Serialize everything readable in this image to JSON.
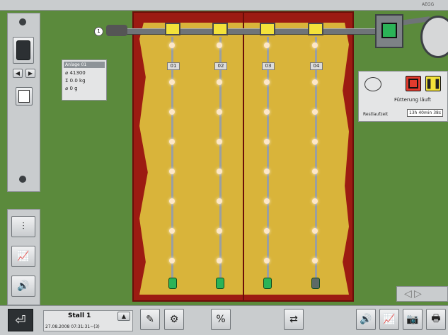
{
  "header": {
    "brand": "AEGG"
  },
  "toolbar": {
    "nav_prev": "◀",
    "nav_next": "▶"
  },
  "info_box": {
    "title": "Anlage 01",
    "rows": [
      {
        "icon": "⌀",
        "value": "41300"
      },
      {
        "icon": "Σ",
        "value": "0.0 kg"
      },
      {
        "icon": "⌀",
        "value": "0 g"
      }
    ]
  },
  "pipe_number": "1",
  "lines": [
    {
      "label": "01",
      "end_color": "#2bb357"
    },
    {
      "label": "02",
      "end_color": "#2bb357"
    },
    {
      "label": "03",
      "end_color": "#2bb357"
    },
    {
      "label": "04",
      "end_color": "#5d6a66"
    }
  ],
  "status_panel": {
    "status_text": "Fütterung läuft",
    "remaining_label": "Restlaufzeit",
    "remaining_value": "13h 40min 38s"
  },
  "scroll_arrows": {
    "left": "◁",
    "right": "▷"
  },
  "footer": {
    "stall_label": "Stall 1",
    "datetime": "27.08.2008 07:31:31~(3)"
  },
  "colors": {
    "background": "#5b8a3c",
    "field": "#9c1b12",
    "floor": "#d9b43a",
    "accent_red": "#e23b2e",
    "accent_yellow": "#f3e23a"
  }
}
